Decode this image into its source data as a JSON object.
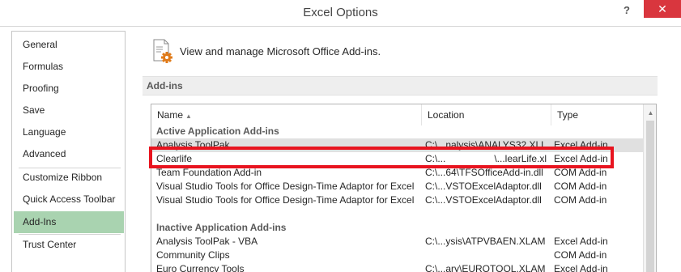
{
  "window": {
    "title": "Excel Options",
    "help_label": "?",
    "close_label": "✕"
  },
  "sidebar": {
    "items": [
      {
        "label": "General",
        "active": false
      },
      {
        "label": "Formulas",
        "active": false
      },
      {
        "label": "Proofing",
        "active": false
      },
      {
        "label": "Save",
        "active": false
      },
      {
        "label": "Language",
        "active": false
      },
      {
        "label": "Advanced",
        "active": false
      },
      {
        "label": "Customize Ribbon",
        "active": false
      },
      {
        "label": "Quick Access Toolbar",
        "active": false
      },
      {
        "label": "Add-Ins",
        "active": true
      },
      {
        "label": "Trust Center",
        "active": false
      }
    ]
  },
  "main": {
    "icon": "addins-gear-icon",
    "heading": "View and manage Microsoft Office Add-ins.",
    "section_title": "Add-ins"
  },
  "table": {
    "columns": {
      "name": "Name",
      "location": "Location",
      "type": "Type"
    },
    "sort_icon": "▲",
    "active_group": "Active Application Add-ins",
    "active_rows": [
      {
        "name": "Analysis ToolPak",
        "location": "C:\\...nalysis\\ANALYS32.XLL",
        "type": "Excel Add-in",
        "selected": true
      },
      {
        "name": "Clearlife",
        "location": "C:\\...                  \\...learLife.xla",
        "type": "Excel Add-in",
        "selected": false
      },
      {
        "name": "Team Foundation Add-in",
        "location": "C:\\...64\\TFSOfficeAdd-in.dll",
        "type": "COM Add-in",
        "selected": false
      },
      {
        "name": "Visual Studio Tools for Office Design-Time Adaptor for Excel",
        "location": "C:\\...VSTOExcelAdaptor.dll",
        "type": "COM Add-in",
        "selected": false
      },
      {
        "name": "Visual Studio Tools for Office Design-Time Adaptor for Excel",
        "location": "C:\\...VSTOExcelAdaptor.dll",
        "type": "COM Add-in",
        "selected": false
      }
    ],
    "inactive_group": "Inactive Application Add-ins",
    "inactive_rows": [
      {
        "name": "Analysis ToolPak - VBA",
        "location": "C:\\...ysis\\ATPVBAEN.XLAM",
        "type": "Excel Add-in"
      },
      {
        "name": "Community Clips",
        "location": "",
        "type": "COM Add-in"
      },
      {
        "name": "Euro Currency Tools",
        "location": "C:\\...ary\\EUROTOOL.XLAM",
        "type": "Excel Add-in"
      }
    ],
    "scroll_up_icon": "▲"
  },
  "annotation": {
    "highlight_color": "#e8141f",
    "highlighted_row": "Clearlife"
  },
  "colors": {
    "close_button": "#d9363e",
    "active_nav": "#a9d3b0",
    "selected_row": "#e0e0e0",
    "icon_accent": "#e07b1a"
  }
}
